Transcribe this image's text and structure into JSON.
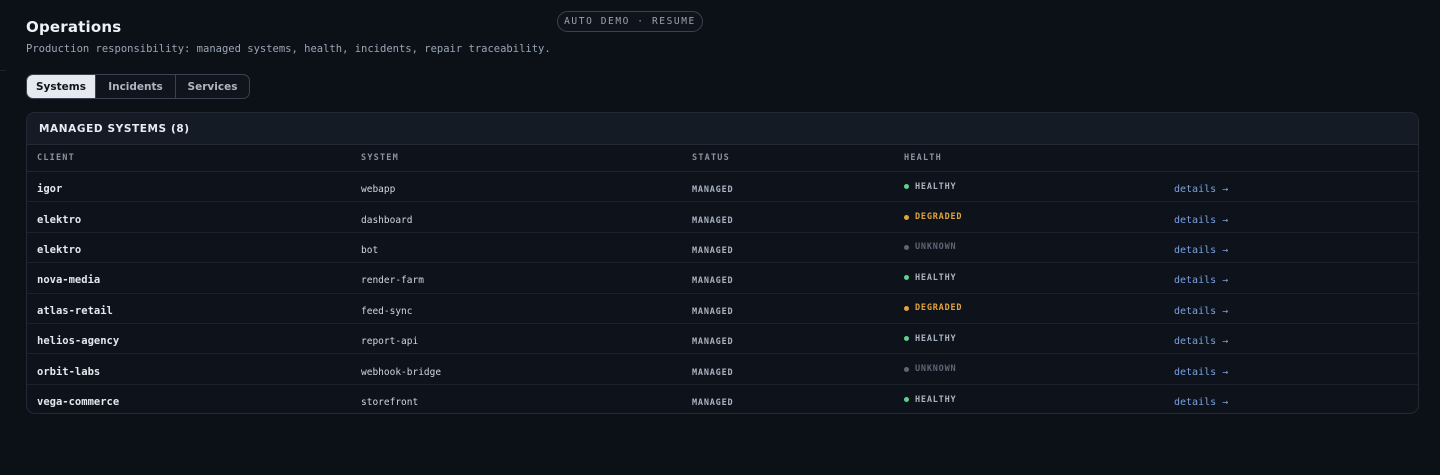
{
  "header": {
    "title": "Operations",
    "subtitle": "Production responsibility: managed systems, health, incidents, repair traceability.",
    "demo_badge": "AUTO DEMO · RESUME"
  },
  "tabs": [
    {
      "label": "Systems",
      "active": true
    },
    {
      "label": "Incidents",
      "active": false
    },
    {
      "label": "Services",
      "active": false
    }
  ],
  "panel": {
    "title": "MANAGED SYSTEMS (8)",
    "columns": [
      "CLIENT",
      "SYSTEM",
      "STATUS",
      "HEALTH"
    ]
  },
  "rows": [
    {
      "client": "igor",
      "system": "webapp",
      "status": "MANAGED",
      "health": "HEALTHY",
      "link": "details →"
    },
    {
      "client": "elektro",
      "system": "dashboard",
      "status": "MANAGED",
      "health": "DEGRADED",
      "link": "details →"
    },
    {
      "client": "elektro",
      "system": "bot",
      "status": "MANAGED",
      "health": "UNKNOWN",
      "link": "details →"
    },
    {
      "client": "nova-media",
      "system": "render-farm",
      "status": "MANAGED",
      "health": "HEALTHY",
      "link": "details →"
    },
    {
      "client": "atlas-retail",
      "system": "feed-sync",
      "status": "MANAGED",
      "health": "DEGRADED",
      "link": "details →"
    },
    {
      "client": "helios-agency",
      "system": "report-api",
      "status": "MANAGED",
      "health": "HEALTHY",
      "link": "details →"
    },
    {
      "client": "orbit-labs",
      "system": "webhook-bridge",
      "status": "MANAGED",
      "health": "UNKNOWN",
      "link": "details →"
    },
    {
      "client": "vega-commerce",
      "system": "storefront",
      "status": "MANAGED",
      "health": "HEALTHY",
      "link": "details →"
    }
  ],
  "colors": {
    "background": "#0c1017",
    "healthy": "#5fd08f",
    "degraded": "#e0a43c",
    "unknown": "#5d6676",
    "link": "#7aa0e0"
  }
}
